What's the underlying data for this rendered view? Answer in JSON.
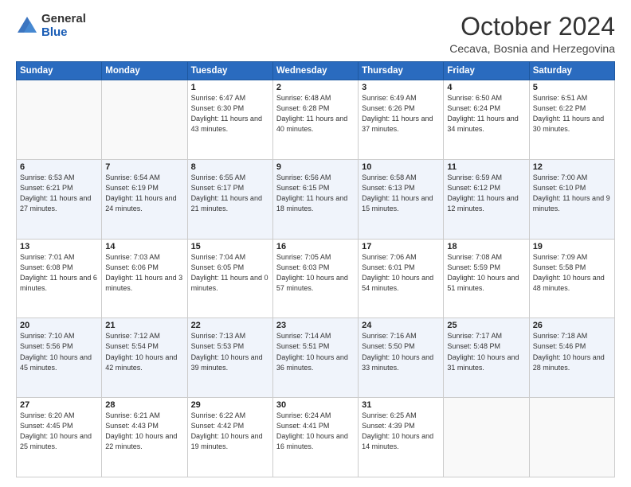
{
  "header": {
    "logo_general": "General",
    "logo_blue": "Blue",
    "month_title": "October 2024",
    "location": "Cecava, Bosnia and Herzegovina"
  },
  "weekdays": [
    "Sunday",
    "Monday",
    "Tuesday",
    "Wednesday",
    "Thursday",
    "Friday",
    "Saturday"
  ],
  "weeks": [
    [
      {
        "day": "",
        "sunrise": "",
        "sunset": "",
        "daylight": ""
      },
      {
        "day": "",
        "sunrise": "",
        "sunset": "",
        "daylight": ""
      },
      {
        "day": "1",
        "sunrise": "Sunrise: 6:47 AM",
        "sunset": "Sunset: 6:30 PM",
        "daylight": "Daylight: 11 hours and 43 minutes."
      },
      {
        "day": "2",
        "sunrise": "Sunrise: 6:48 AM",
        "sunset": "Sunset: 6:28 PM",
        "daylight": "Daylight: 11 hours and 40 minutes."
      },
      {
        "day": "3",
        "sunrise": "Sunrise: 6:49 AM",
        "sunset": "Sunset: 6:26 PM",
        "daylight": "Daylight: 11 hours and 37 minutes."
      },
      {
        "day": "4",
        "sunrise": "Sunrise: 6:50 AM",
        "sunset": "Sunset: 6:24 PM",
        "daylight": "Daylight: 11 hours and 34 minutes."
      },
      {
        "day": "5",
        "sunrise": "Sunrise: 6:51 AM",
        "sunset": "Sunset: 6:22 PM",
        "daylight": "Daylight: 11 hours and 30 minutes."
      }
    ],
    [
      {
        "day": "6",
        "sunrise": "Sunrise: 6:53 AM",
        "sunset": "Sunset: 6:21 PM",
        "daylight": "Daylight: 11 hours and 27 minutes."
      },
      {
        "day": "7",
        "sunrise": "Sunrise: 6:54 AM",
        "sunset": "Sunset: 6:19 PM",
        "daylight": "Daylight: 11 hours and 24 minutes."
      },
      {
        "day": "8",
        "sunrise": "Sunrise: 6:55 AM",
        "sunset": "Sunset: 6:17 PM",
        "daylight": "Daylight: 11 hours and 21 minutes."
      },
      {
        "day": "9",
        "sunrise": "Sunrise: 6:56 AM",
        "sunset": "Sunset: 6:15 PM",
        "daylight": "Daylight: 11 hours and 18 minutes."
      },
      {
        "day": "10",
        "sunrise": "Sunrise: 6:58 AM",
        "sunset": "Sunset: 6:13 PM",
        "daylight": "Daylight: 11 hours and 15 minutes."
      },
      {
        "day": "11",
        "sunrise": "Sunrise: 6:59 AM",
        "sunset": "Sunset: 6:12 PM",
        "daylight": "Daylight: 11 hours and 12 minutes."
      },
      {
        "day": "12",
        "sunrise": "Sunrise: 7:00 AM",
        "sunset": "Sunset: 6:10 PM",
        "daylight": "Daylight: 11 hours and 9 minutes."
      }
    ],
    [
      {
        "day": "13",
        "sunrise": "Sunrise: 7:01 AM",
        "sunset": "Sunset: 6:08 PM",
        "daylight": "Daylight: 11 hours and 6 minutes."
      },
      {
        "day": "14",
        "sunrise": "Sunrise: 7:03 AM",
        "sunset": "Sunset: 6:06 PM",
        "daylight": "Daylight: 11 hours and 3 minutes."
      },
      {
        "day": "15",
        "sunrise": "Sunrise: 7:04 AM",
        "sunset": "Sunset: 6:05 PM",
        "daylight": "Daylight: 11 hours and 0 minutes."
      },
      {
        "day": "16",
        "sunrise": "Sunrise: 7:05 AM",
        "sunset": "Sunset: 6:03 PM",
        "daylight": "Daylight: 10 hours and 57 minutes."
      },
      {
        "day": "17",
        "sunrise": "Sunrise: 7:06 AM",
        "sunset": "Sunset: 6:01 PM",
        "daylight": "Daylight: 10 hours and 54 minutes."
      },
      {
        "day": "18",
        "sunrise": "Sunrise: 7:08 AM",
        "sunset": "Sunset: 5:59 PM",
        "daylight": "Daylight: 10 hours and 51 minutes."
      },
      {
        "day": "19",
        "sunrise": "Sunrise: 7:09 AM",
        "sunset": "Sunset: 5:58 PM",
        "daylight": "Daylight: 10 hours and 48 minutes."
      }
    ],
    [
      {
        "day": "20",
        "sunrise": "Sunrise: 7:10 AM",
        "sunset": "Sunset: 5:56 PM",
        "daylight": "Daylight: 10 hours and 45 minutes."
      },
      {
        "day": "21",
        "sunrise": "Sunrise: 7:12 AM",
        "sunset": "Sunset: 5:54 PM",
        "daylight": "Daylight: 10 hours and 42 minutes."
      },
      {
        "day": "22",
        "sunrise": "Sunrise: 7:13 AM",
        "sunset": "Sunset: 5:53 PM",
        "daylight": "Daylight: 10 hours and 39 minutes."
      },
      {
        "day": "23",
        "sunrise": "Sunrise: 7:14 AM",
        "sunset": "Sunset: 5:51 PM",
        "daylight": "Daylight: 10 hours and 36 minutes."
      },
      {
        "day": "24",
        "sunrise": "Sunrise: 7:16 AM",
        "sunset": "Sunset: 5:50 PM",
        "daylight": "Daylight: 10 hours and 33 minutes."
      },
      {
        "day": "25",
        "sunrise": "Sunrise: 7:17 AM",
        "sunset": "Sunset: 5:48 PM",
        "daylight": "Daylight: 10 hours and 31 minutes."
      },
      {
        "day": "26",
        "sunrise": "Sunrise: 7:18 AM",
        "sunset": "Sunset: 5:46 PM",
        "daylight": "Daylight: 10 hours and 28 minutes."
      }
    ],
    [
      {
        "day": "27",
        "sunrise": "Sunrise: 6:20 AM",
        "sunset": "Sunset: 4:45 PM",
        "daylight": "Daylight: 10 hours and 25 minutes."
      },
      {
        "day": "28",
        "sunrise": "Sunrise: 6:21 AM",
        "sunset": "Sunset: 4:43 PM",
        "daylight": "Daylight: 10 hours and 22 minutes."
      },
      {
        "day": "29",
        "sunrise": "Sunrise: 6:22 AM",
        "sunset": "Sunset: 4:42 PM",
        "daylight": "Daylight: 10 hours and 19 minutes."
      },
      {
        "day": "30",
        "sunrise": "Sunrise: 6:24 AM",
        "sunset": "Sunset: 4:41 PM",
        "daylight": "Daylight: 10 hours and 16 minutes."
      },
      {
        "day": "31",
        "sunrise": "Sunrise: 6:25 AM",
        "sunset": "Sunset: 4:39 PM",
        "daylight": "Daylight: 10 hours and 14 minutes."
      },
      {
        "day": "",
        "sunrise": "",
        "sunset": "",
        "daylight": ""
      },
      {
        "day": "",
        "sunrise": "",
        "sunset": "",
        "daylight": ""
      }
    ]
  ]
}
